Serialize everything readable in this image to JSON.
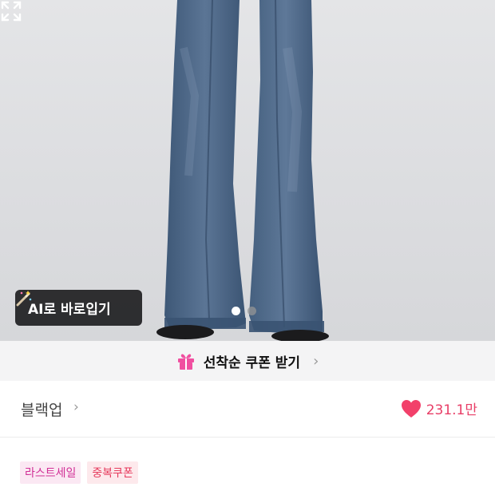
{
  "hero": {
    "ai_button_label": "AI로 바로입기",
    "carousel_total": 2,
    "carousel_active": 1
  },
  "coupon": {
    "label": "선착순 쿠폰 받기",
    "chevron": "›"
  },
  "brand": {
    "name": "블랙업",
    "chevron": "›"
  },
  "likes": {
    "count": "231.1만",
    "color": "#f2406a"
  },
  "badges": [
    {
      "label": "라스트세일"
    },
    {
      "label": "중복쿠폰"
    }
  ],
  "icons": {
    "ai": "magic-wand-icon",
    "expand": "expand-icon",
    "gift": "gift-icon",
    "heart": "heart-icon"
  }
}
